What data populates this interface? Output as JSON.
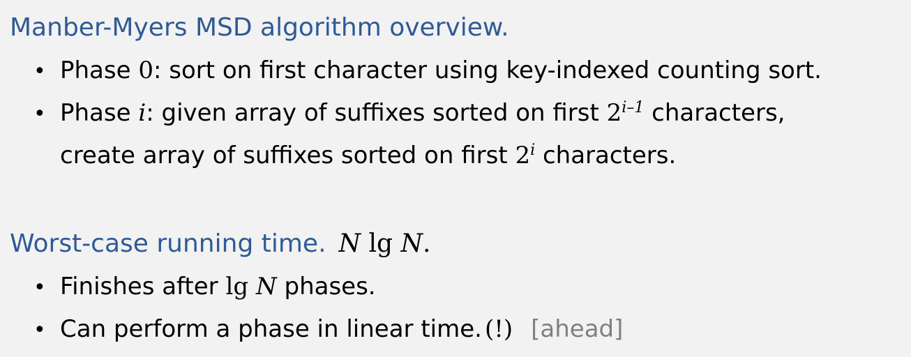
{
  "sections": {
    "overview": {
      "heading": "Manber-Myers MSD algorithm overview.",
      "bullet1": {
        "label": "Phase",
        "num": "0",
        "text": ":  sort on first character using key-indexed counting sort."
      },
      "bullet2": {
        "label": "Phase",
        "var": "i",
        "text": ":  given array of suffixes sorted on first",
        "base": "2",
        "exp": "i–1",
        "tail": "characters,",
        "line2_text": "create array of suffixes sorted on first",
        "line2_base": "2",
        "line2_exp": "i",
        "line2_tail": "characters."
      }
    },
    "running_time": {
      "heading": "Worst-case running time.",
      "formula_n1": "N",
      "formula_lg": "lg",
      "formula_n2": "N",
      "formula_end": ".",
      "bullet1": {
        "pre": "Finishes after",
        "lg": "lg",
        "n": "N",
        "post": "phases."
      },
      "bullet2": {
        "text": "Can perform a phase in linear time.",
        "exclaim": "(!)",
        "aside": "[ahead]"
      }
    }
  },
  "colors": {
    "heading": "#2e5a96",
    "background": "#f2f2f2",
    "aside": "#808080",
    "text": "#000000"
  }
}
